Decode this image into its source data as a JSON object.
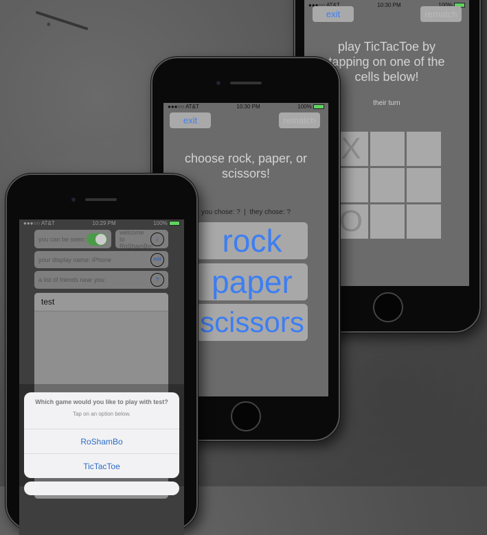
{
  "tictactoe_screen": {
    "status": {
      "carrier": "●●●○○ AT&T",
      "time": "10:30 PM",
      "battery": "100%"
    },
    "exit": "exit",
    "rematch": "rematch",
    "title": "play TicTacToe by tapping on one of the cells below!",
    "turn": "their turn",
    "cells": [
      "X",
      "",
      "",
      "",
      "",
      "",
      "O",
      "",
      ""
    ]
  },
  "rps_screen": {
    "status": {
      "carrier": "●●●○○ AT&T",
      "time": "10:30 PM",
      "battery": "100%"
    },
    "exit": "exit",
    "rematch": "rematch",
    "title": "choose rock, paper, or scissors!",
    "choices_status": "you chose: ?  |  they chose: ?",
    "choices": [
      "rock",
      "paper",
      "scissors"
    ]
  },
  "lobby_screen": {
    "status": {
      "carrier": "●●●○○ AT&T",
      "time": "10:29 PM",
      "battery": "100%"
    },
    "visibility_label": "you can be seen:",
    "welcome": "welcome to RoShamBo!",
    "info_icon": "i",
    "display_name": "your display name: iPhone",
    "edit": "edit",
    "friends_label": "a list of friends near you:",
    "help_icon": "?",
    "friends": [
      "test"
    ],
    "alert": {
      "title": "Which game would you like to play with test?",
      "message": "Tap on an option below.",
      "options": [
        "RoShamBo",
        "TicTacToe"
      ]
    }
  }
}
